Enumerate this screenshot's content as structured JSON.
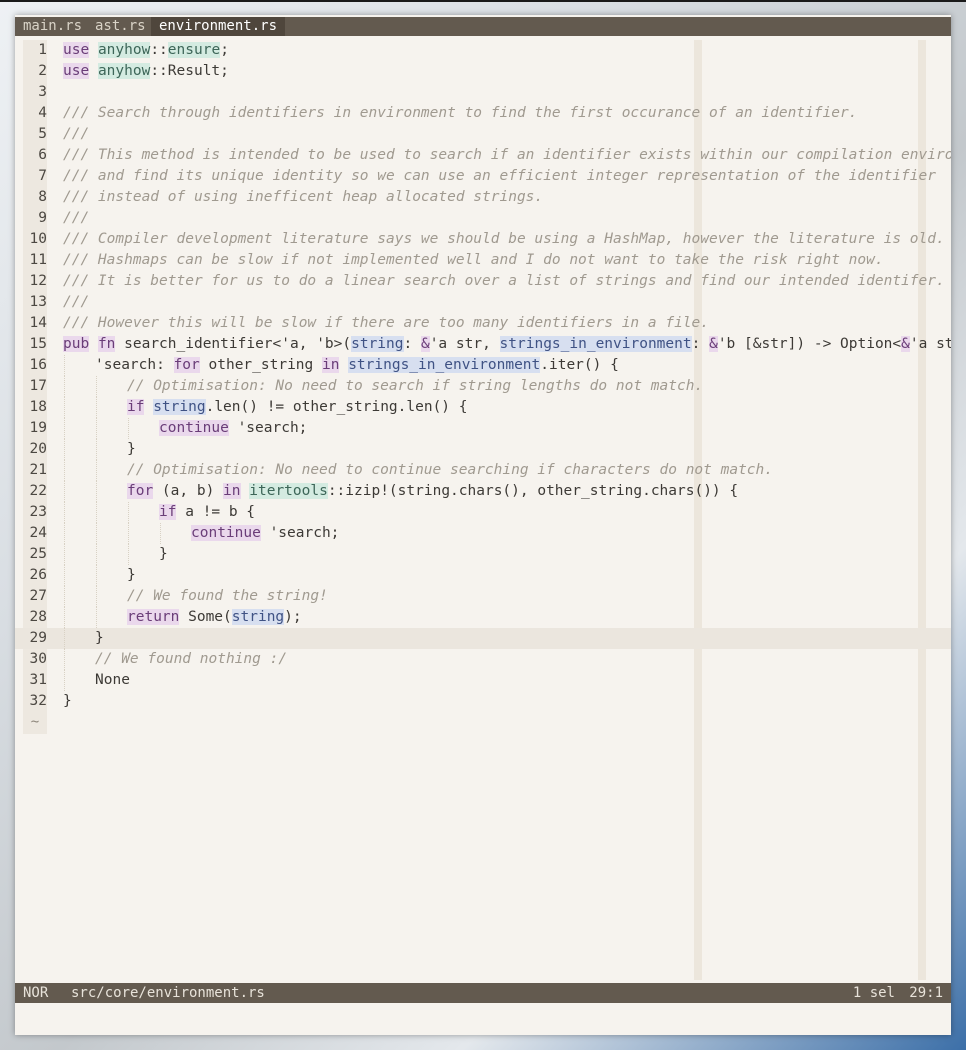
{
  "tabs": [
    {
      "label": "main.rs",
      "active": false
    },
    {
      "label": "ast.rs",
      "active": false
    },
    {
      "label": "environment.rs",
      "active": true
    }
  ],
  "cursor_line": 29,
  "lines": [
    {
      "n": "1",
      "i": 0,
      "t": [
        [
          "use",
          "kw"
        ],
        [
          " ",
          ""
        ],
        [
          "anyhow",
          "md"
        ],
        [
          "::",
          ""
        ],
        [
          "ensure",
          "md"
        ],
        [
          ";",
          ""
        ]
      ]
    },
    {
      "n": "2",
      "i": 0,
      "t": [
        [
          "use",
          "kw"
        ],
        [
          " ",
          ""
        ],
        [
          "anyhow",
          "md"
        ],
        [
          "::Result;",
          ""
        ]
      ]
    },
    {
      "n": "3",
      "i": 0,
      "t": []
    },
    {
      "n": "4",
      "i": 0,
      "t": [
        [
          "/// Search through identifiers in environment to find the first occurance of an identifier.",
          "cm"
        ]
      ]
    },
    {
      "n": "5",
      "i": 0,
      "t": [
        [
          "///",
          "cm"
        ]
      ]
    },
    {
      "n": "6",
      "i": 0,
      "t": [
        [
          "/// This method is intended to be used to search if an identifier exists within our compilation environment",
          "cm"
        ]
      ]
    },
    {
      "n": "7",
      "i": 0,
      "t": [
        [
          "/// and find its unique identity so we can use an efficient integer representation of the identifier",
          "cm"
        ]
      ]
    },
    {
      "n": "8",
      "i": 0,
      "t": [
        [
          "/// instead of using inefficent heap allocated strings.",
          "cm"
        ]
      ]
    },
    {
      "n": "9",
      "i": 0,
      "t": [
        [
          "///",
          "cm"
        ]
      ]
    },
    {
      "n": "10",
      "i": 0,
      "t": [
        [
          "/// Compiler development literature says we should be using a HashMap, however the literature is old.",
          "cm"
        ]
      ]
    },
    {
      "n": "11",
      "i": 0,
      "t": [
        [
          "/// Hashmaps can be slow if not implemented well and I do not want to take the risk right now.",
          "cm"
        ]
      ]
    },
    {
      "n": "12",
      "i": 0,
      "t": [
        [
          "/// It is better for us to do a linear search over a list of strings and find our intended identifer.",
          "cm"
        ]
      ]
    },
    {
      "n": "13",
      "i": 0,
      "t": [
        [
          "///",
          "cm"
        ]
      ]
    },
    {
      "n": "14",
      "i": 0,
      "t": [
        [
          "/// However this will be slow if there are too many identifiers in a file.",
          "cm"
        ]
      ]
    },
    {
      "n": "15",
      "i": 0,
      "t": [
        [
          "pub",
          "kw"
        ],
        [
          " ",
          ""
        ],
        [
          "fn",
          "kw"
        ],
        [
          " search_identifier<'a, 'b>(",
          ""
        ],
        [
          "string",
          "pm"
        ],
        [
          ": ",
          ""
        ],
        [
          "&",
          "kw"
        ],
        [
          "'a str, ",
          ""
        ],
        [
          "strings_in_environment",
          "pm"
        ],
        [
          ": ",
          ""
        ],
        [
          "&",
          "kw"
        ],
        [
          "'b [&str]) -> Option<",
          ""
        ],
        [
          "&",
          "kw"
        ],
        [
          "'a str> {",
          ""
        ]
      ]
    },
    {
      "n": "16",
      "i": 1,
      "t": [
        [
          "'search: ",
          ""
        ],
        [
          "for",
          "kw"
        ],
        [
          " other_string ",
          ""
        ],
        [
          "in",
          "kw"
        ],
        [
          " ",
          ""
        ],
        [
          "strings_in_environment",
          "pm"
        ],
        [
          ".iter() {",
          ""
        ]
      ]
    },
    {
      "n": "17",
      "i": 2,
      "t": [
        [
          "// Optimisation: No need to search if string lengths do not match.",
          "cm"
        ]
      ]
    },
    {
      "n": "18",
      "i": 2,
      "t": [
        [
          "if",
          "kw"
        ],
        [
          " ",
          ""
        ],
        [
          "string",
          "pm"
        ],
        [
          ".len() != other_string.len() {",
          ""
        ]
      ]
    },
    {
      "n": "19",
      "i": 3,
      "t": [
        [
          "continue",
          "kw"
        ],
        [
          " 'search;",
          ""
        ]
      ]
    },
    {
      "n": "20",
      "i": 2,
      "t": [
        [
          "}",
          ""
        ]
      ]
    },
    {
      "n": "21",
      "i": 2,
      "t": [
        [
          "// Optimisation: No need to continue searching if characters do not match.",
          "cm"
        ]
      ]
    },
    {
      "n": "22",
      "i": 2,
      "t": [
        [
          "for",
          "kw"
        ],
        [
          " (a, b) ",
          ""
        ],
        [
          "in",
          "kw"
        ],
        [
          " ",
          ""
        ],
        [
          "itertools",
          "md"
        ],
        [
          "::izip!(string.chars(), other_string.chars()) {",
          ""
        ]
      ]
    },
    {
      "n": "23",
      "i": 3,
      "t": [
        [
          "if",
          "kw"
        ],
        [
          " a != b {",
          ""
        ]
      ]
    },
    {
      "n": "24",
      "i": 4,
      "t": [
        [
          "continue",
          "kw"
        ],
        [
          " 'search;",
          ""
        ]
      ]
    },
    {
      "n": "25",
      "i": 3,
      "t": [
        [
          "}",
          ""
        ]
      ]
    },
    {
      "n": "26",
      "i": 2,
      "t": [
        [
          "}",
          ""
        ]
      ]
    },
    {
      "n": "27",
      "i": 2,
      "t": [
        [
          "// We found the string!",
          "cm"
        ]
      ]
    },
    {
      "n": "28",
      "i": 2,
      "t": [
        [
          "return",
          "kw"
        ],
        [
          " Some(",
          ""
        ],
        [
          "string",
          "pm"
        ],
        [
          ");",
          ""
        ]
      ]
    },
    {
      "n": "29",
      "i": 1,
      "t": [
        [
          "}",
          ""
        ]
      ]
    },
    {
      "n": "30",
      "i": 1,
      "t": [
        [
          "// We found nothing :/",
          "cm"
        ]
      ]
    },
    {
      "n": "31",
      "i": 1,
      "t": [
        [
          "None",
          ""
        ]
      ]
    },
    {
      "n": "32",
      "i": 0,
      "t": [
        [
          "}",
          ""
        ]
      ]
    }
  ],
  "empty_marker": "~",
  "status": {
    "mode": "NOR",
    "file": "src/core/environment.rs",
    "selection": "1 sel",
    "position": "29:1"
  },
  "colors": {
    "bar": "#635a4f",
    "background": "#f6f3ee",
    "keyword_bg": "#ead8ec",
    "module_bg": "#d4ebe1",
    "param_bg": "#d7dff0",
    "comment": "#a09a90"
  }
}
